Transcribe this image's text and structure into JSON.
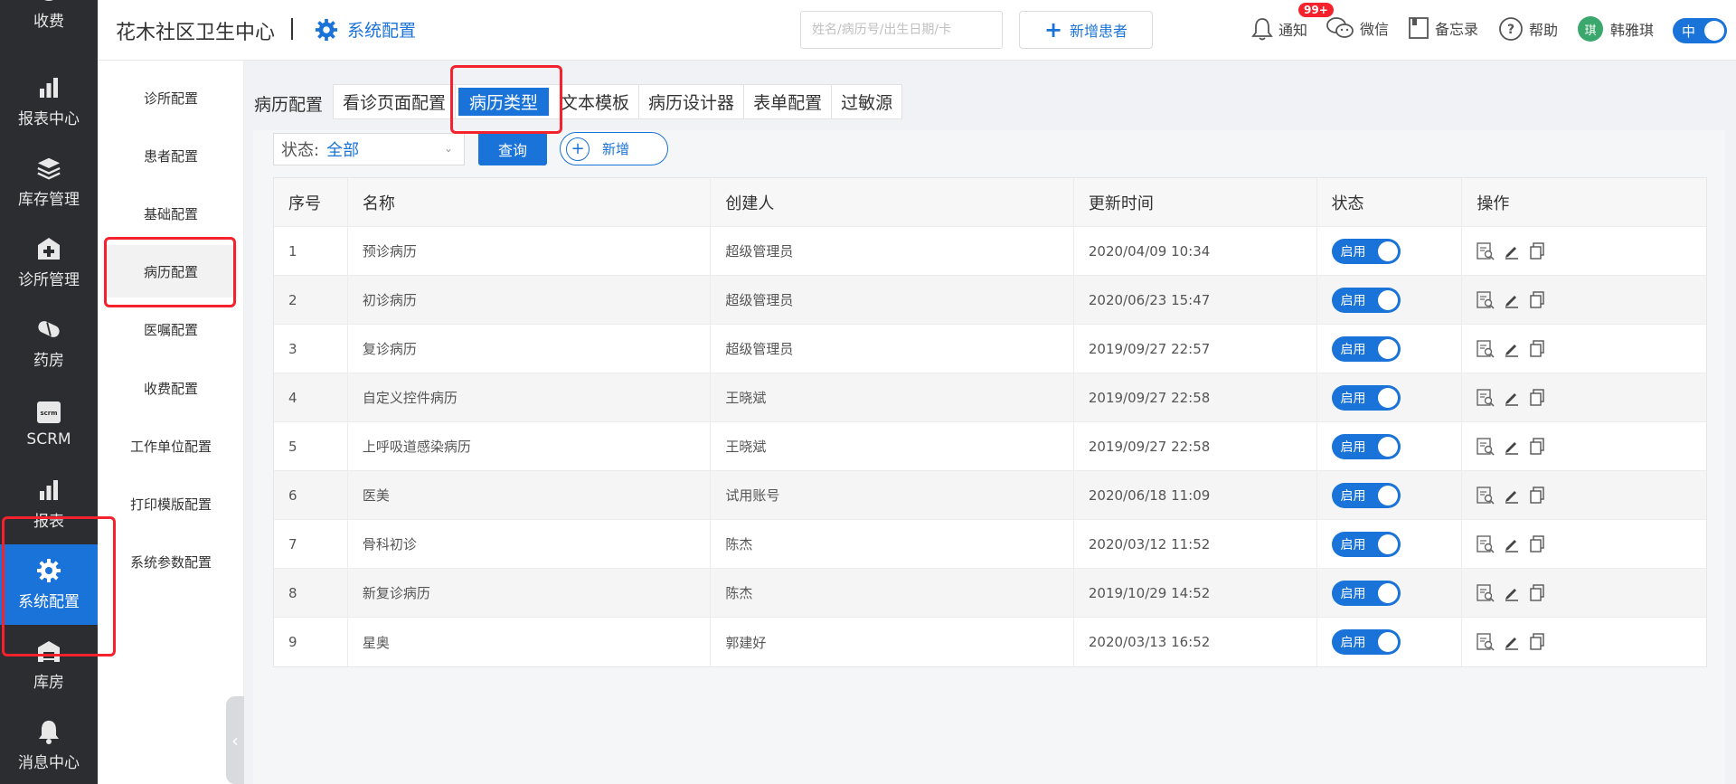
{
  "leftnav": {
    "items": [
      {
        "label": "收费",
        "icon": "yen-icon"
      },
      {
        "label": "报表中心",
        "icon": "bar-chart-icon"
      },
      {
        "label": "库存管理",
        "icon": "layers-icon"
      },
      {
        "label": "诊所管理",
        "icon": "clinic-icon"
      },
      {
        "label": "药房",
        "icon": "pill-icon"
      },
      {
        "label": "SCRM",
        "icon": "scrm-icon"
      },
      {
        "label": "报表",
        "icon": "bar-chart-icon"
      },
      {
        "label": "系统配置",
        "icon": "gear-icon"
      },
      {
        "label": "库房",
        "icon": "warehouse-icon"
      },
      {
        "label": "消息中心",
        "icon": "bell-icon"
      }
    ]
  },
  "header": {
    "org_name": "花木社区卫生中心",
    "module": "系统配置",
    "search_placeholder": "姓名/病历号/出生日期/卡",
    "new_patient": "新增患者",
    "notify": "通知",
    "notify_badge": "99+",
    "wechat": "微信",
    "memo": "备忘录",
    "help": "帮助",
    "user_initial": "琪",
    "user_name": "韩雅琪",
    "lang": "中"
  },
  "subnav": {
    "items": [
      "诊所配置",
      "患者配置",
      "基础配置",
      "病历配置",
      "医嘱配置",
      "收费配置",
      "工作单位配置",
      "打印模版配置",
      "系统参数配置"
    ]
  },
  "tabs": {
    "label": "病历配置",
    "items": [
      "看诊页面配置",
      "病历类型",
      "文本模板",
      "病历设计器",
      "表单配置",
      "过敏源"
    ]
  },
  "filter": {
    "status_label": "状态:",
    "status_value": "全部",
    "query": "查询",
    "add": "新增"
  },
  "table": {
    "headers": [
      "序号",
      "名称",
      "创建人",
      "更新时间",
      "状态",
      "操作"
    ],
    "rows": [
      {
        "no": "1",
        "name": "预诊病历",
        "creator": "超级管理员",
        "updated": "2020/04/09 10:34",
        "status": "启用"
      },
      {
        "no": "2",
        "name": "初诊病历",
        "creator": "超级管理员",
        "updated": "2020/06/23 15:47",
        "status": "启用"
      },
      {
        "no": "3",
        "name": "复诊病历",
        "creator": "超级管理员",
        "updated": "2019/09/27 22:57",
        "status": "启用"
      },
      {
        "no": "4",
        "name": "自定义控件病历",
        "creator": "王晓斌",
        "updated": "2019/09/27 22:58",
        "status": "启用"
      },
      {
        "no": "5",
        "name": "上呼吸道感染病历",
        "creator": "王晓斌",
        "updated": "2019/09/27 22:58",
        "status": "启用"
      },
      {
        "no": "6",
        "name": "医美",
        "creator": "试用账号",
        "updated": "2020/06/18 11:09",
        "status": "启用"
      },
      {
        "no": "7",
        "name": "骨科初诊",
        "creator": "陈杰",
        "updated": "2020/03/12 11:52",
        "status": "启用"
      },
      {
        "no": "8",
        "name": "新复诊病历",
        "creator": "陈杰",
        "updated": "2019/10/29 14:52",
        "status": "启用"
      },
      {
        "no": "9",
        "name": "星奥",
        "creator": "郭建好",
        "updated": "2020/03/13 16:52",
        "status": "启用"
      }
    ]
  },
  "colors": {
    "accent": "#1a73d9",
    "nav_bg": "#2b2d30",
    "highlight": "#f5222d"
  }
}
